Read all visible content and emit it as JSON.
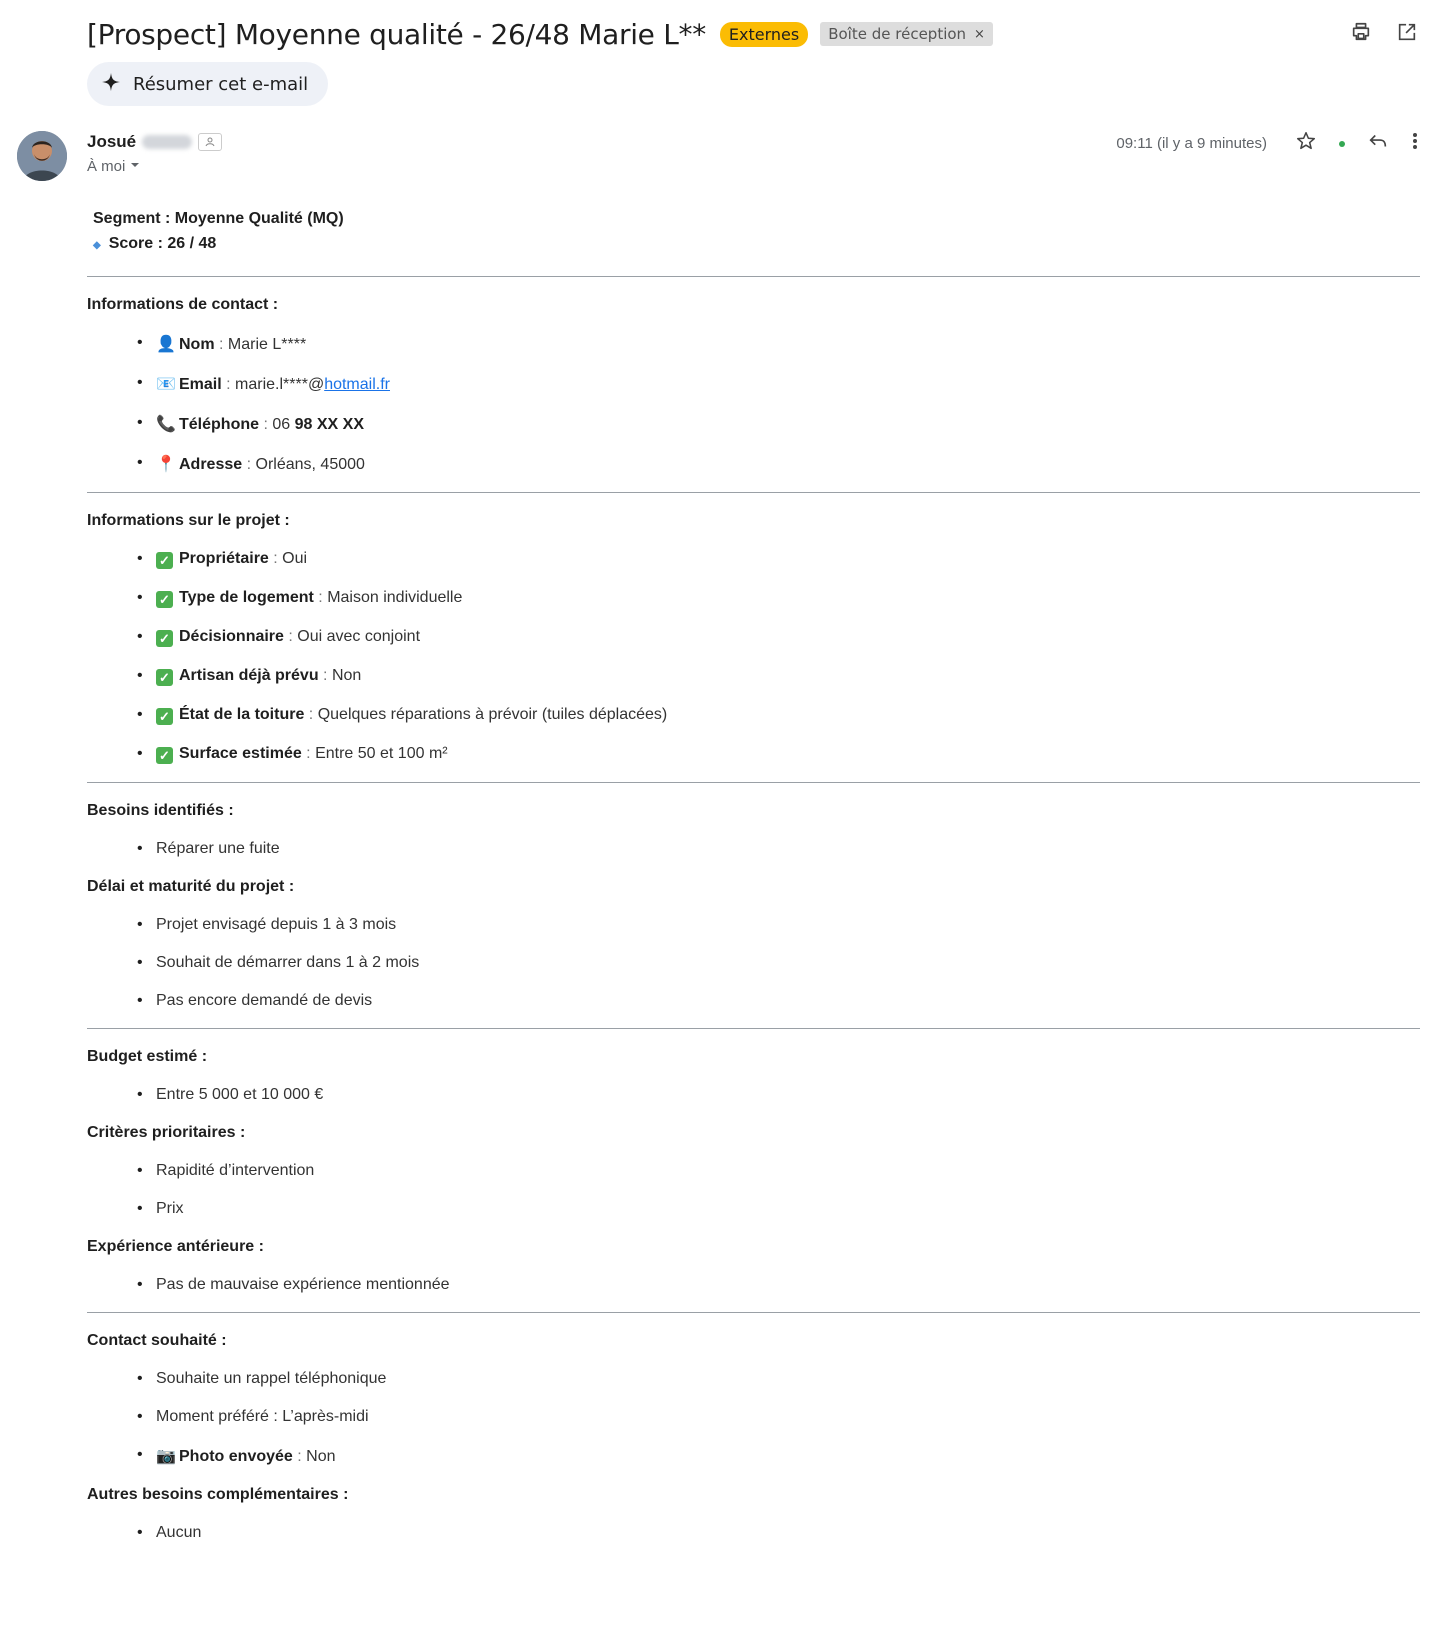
{
  "header": {
    "subject": "[Prospect] Moyenne qualité - 26/48 Marie L**",
    "label_external": "Externes",
    "label_inbox": "Boîte de réception",
    "label_remove": "×",
    "print_icon": "printer-icon",
    "popout_icon": "open-in-new-window-icon",
    "summarize_label": "Résumer cet e-mail"
  },
  "message": {
    "sender_first": "Josué",
    "to_label": "À moi",
    "timestamp": "09:11 (il y a 9 minutes)"
  },
  "content": {
    "segment": "Segment : Moyenne Qualité (MQ)",
    "score": "Score : 26 / 48",
    "contact_title": "Informations de contact :",
    "contact": {
      "nom_label": "Nom",
      "nom_value": "Marie L****",
      "email_label": "Email",
      "email_prefix": "marie.l****@",
      "email_link": "hotmail.fr",
      "tel_label": "Téléphone",
      "tel_value_a": "06 ",
      "tel_value_b": "98 XX XX",
      "addr_label": "Adresse",
      "addr_value": "Orléans, 45000"
    },
    "sep": " : ",
    "project_title": "Informations sur le projet :",
    "project": [
      {
        "label": "Propriétaire",
        "value": "Oui"
      },
      {
        "label": "Type de logement",
        "value": "Maison individuelle"
      },
      {
        "label": "Décisionnaire",
        "value": "Oui avec conjoint"
      },
      {
        "label": "Artisan déjà prévu",
        "value": "Non"
      },
      {
        "label": "État de la toiture",
        "value": "Quelques réparations à prévoir (tuiles déplacées)"
      },
      {
        "label": "Surface estimée",
        "value": "Entre 50 et 100 m²"
      }
    ],
    "needs_title": "Besoins identifiés :",
    "needs": [
      "Réparer une fuite"
    ],
    "delay_title": "Délai et maturité du projet :",
    "delay": [
      "Projet envisagé depuis 1 à 3 mois",
      "Souhait de démarrer dans 1 à 2 mois",
      "Pas encore demandé de devis"
    ],
    "budget_title": "Budget estimé :",
    "budget": [
      "Entre 5 000 et 10 000 €"
    ],
    "criteria_title": "Critères prioritaires :",
    "criteria": [
      "Rapidité d’intervention",
      "Prix"
    ],
    "experience_title": "Expérience antérieure :",
    "experience": [
      "Pas de mauvaise expérience mentionnée"
    ],
    "contactpref_title": "Contact souhaité :",
    "contactpref": [
      "Souhaite un rappel téléphonique",
      "Moment préféré : L’après-midi"
    ],
    "photo_label": "Photo envoyée",
    "photo_value": "Non",
    "other_title": "Autres besoins complémentaires :",
    "other": [
      "Aucun"
    ]
  },
  "icons": {
    "star": "star-icon",
    "online": "online-status-icon",
    "reply": "reply-icon",
    "more": "more-vert-icon",
    "sparkle": "sparkle-icon",
    "person": "person-emoji-icon",
    "email": "envelope-emoji-icon",
    "phone": "phone-emoji-icon",
    "pin": "pin-emoji-icon",
    "check": "check-mark-icon",
    "camera": "camera-emoji-icon"
  },
  "colors": {
    "external_badge": "#fbbc04",
    "online_dot": "#34a853",
    "link": "#1a73e8",
    "check": "#4caf50"
  }
}
